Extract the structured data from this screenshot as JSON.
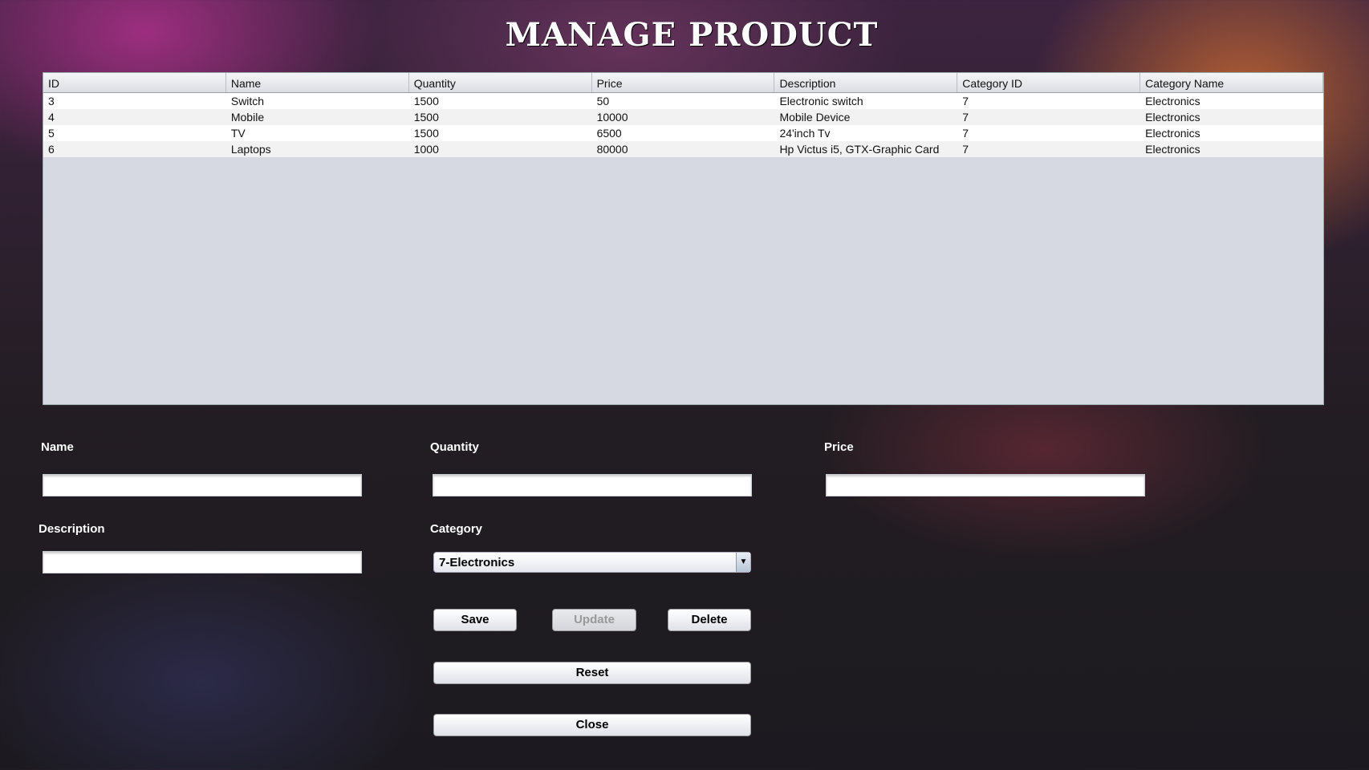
{
  "title": "MANAGE PRODUCT",
  "table": {
    "columns": [
      "ID",
      "Name",
      "Quantity",
      "Price",
      "Description",
      "Category ID",
      "Category Name"
    ],
    "rows": [
      [
        "3",
        "Switch",
        "1500",
        "50",
        "Electronic switch",
        "7",
        "Electronics"
      ],
      [
        "4",
        "Mobile",
        "1500",
        "10000",
        "Mobile Device",
        "7",
        "Electronics"
      ],
      [
        "5",
        "TV",
        "1500",
        "6500",
        "24'inch Tv",
        "7",
        "Electronics"
      ],
      [
        "6",
        "Laptops",
        "1000",
        "80000",
        "Hp Victus i5, GTX-Graphic Card",
        "7",
        "Electronics"
      ]
    ]
  },
  "form": {
    "name_label": "Name",
    "quantity_label": "Quantity",
    "price_label": "Price",
    "description_label": "Description",
    "category_label": "Category",
    "name_value": "",
    "quantity_value": "",
    "price_value": "",
    "description_value": "",
    "category_selected": "7-Electronics"
  },
  "buttons": {
    "save": "Save",
    "update": "Update",
    "delete": "Delete",
    "reset": "Reset",
    "close": "Close"
  },
  "icons": {
    "dropdown": "chevron-down-icon"
  }
}
